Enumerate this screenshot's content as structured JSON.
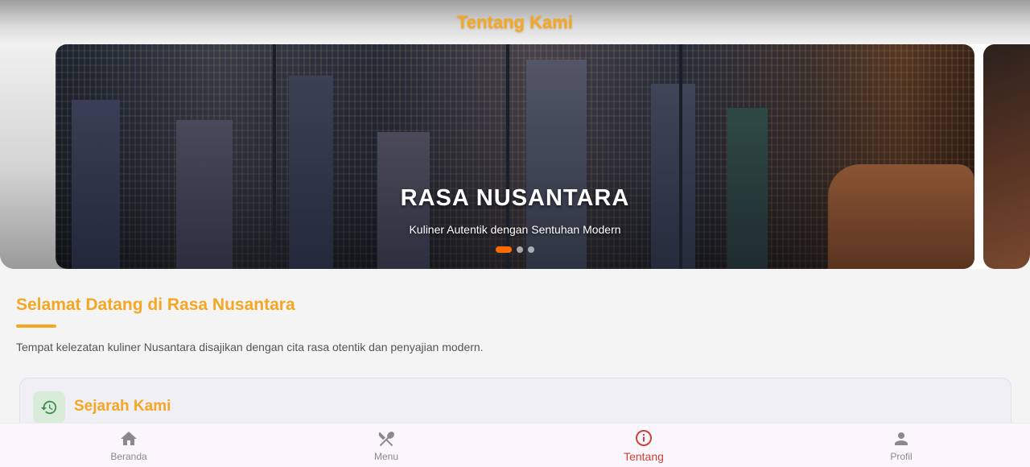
{
  "appbar": {
    "title": "Tentang Kami"
  },
  "hero": {
    "title": "RASA NUSANTARA",
    "subtitle": "Kuliner Autentik dengan Sentuhan Modern",
    "slide_count": 3,
    "active_slide": 1
  },
  "welcome": {
    "title": "Selamat Datang di Rasa Nusantara",
    "description": "Tempat kelezatan kuliner Nusantara disajikan dengan cita rasa otentik dan penyajian modern."
  },
  "history_card": {
    "title": "Sejarah Kami",
    "icon": "history-icon"
  },
  "bottom_nav": {
    "items": [
      {
        "label": "Beranda",
        "icon": "home-icon"
      },
      {
        "label": "Menu",
        "icon": "restaurant-icon"
      },
      {
        "label": "Tentang",
        "icon": "info-icon",
        "active": true
      },
      {
        "label": "Profil",
        "icon": "person-icon"
      }
    ]
  },
  "colors": {
    "accent": "#f5a623",
    "active_nav": "#d0413a",
    "carousel_active_dot": "#ff6a00"
  }
}
